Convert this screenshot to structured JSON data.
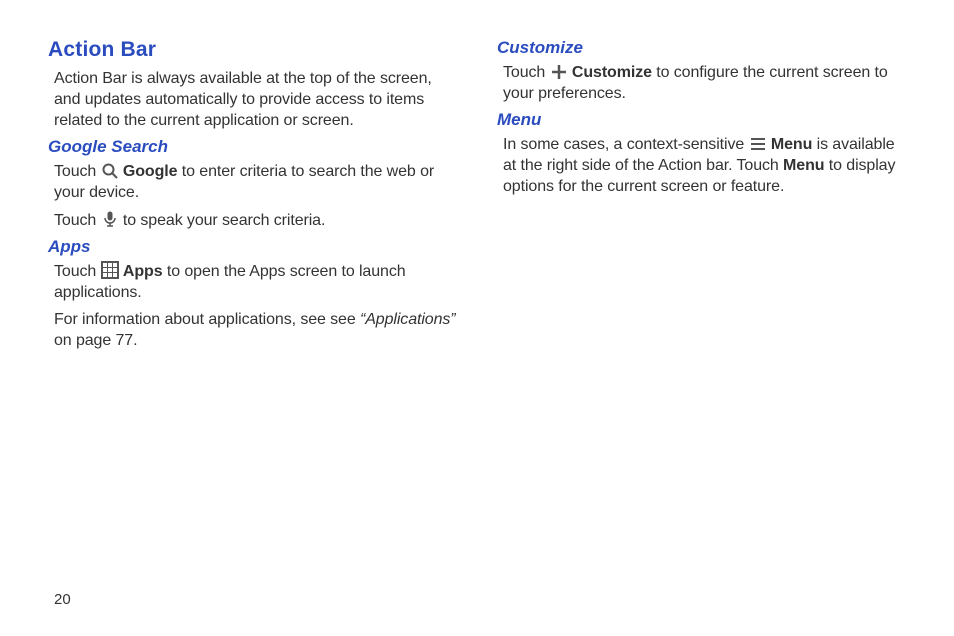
{
  "left": {
    "title": "Action Bar",
    "intro": "Action Bar is always available at the top of the screen, and updates automatically to provide access to items related to the current application or screen.",
    "google": {
      "heading": "Google Search",
      "line1_pre": "Touch ",
      "line1_bold": "Google",
      "line1_post": " to enter criteria to search the web or your device.",
      "line2_pre": "Touch ",
      "line2_post": " to speak your search criteria."
    },
    "apps": {
      "heading": "Apps",
      "line1_pre": "Touch ",
      "line1_bold": "Apps",
      "line1_post": " to open the Apps screen to launch applications.",
      "line2_pre": "For information about applications, see see ",
      "line2_ital": "“Applications”",
      "line2_post": " on page 77."
    }
  },
  "right": {
    "customize": {
      "heading": "Customize",
      "line_pre": "Touch ",
      "line_bold": "Customize",
      "line_post": " to configure the current screen to your preferences."
    },
    "menu": {
      "heading": "Menu",
      "line_pre": "In some cases, a context-sensitive ",
      "line_bold1": "Menu",
      "line_mid": " is available at the right side of the Action bar. Touch ",
      "line_bold2": "Menu",
      "line_post": " to display options for the current screen or feature."
    }
  },
  "page_number": "20"
}
